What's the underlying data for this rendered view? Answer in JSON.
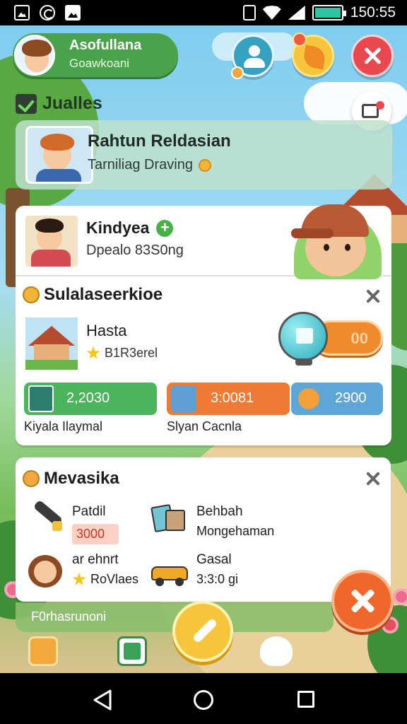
{
  "status_bar": {
    "time": "150:55"
  },
  "profile": {
    "name": "Asofullana",
    "subtitle": "Goawkoani"
  },
  "section": {
    "title": "Jualles"
  },
  "banner": {
    "title": "Rahtun Reldasian",
    "subtitle": "Tarniliag Draving"
  },
  "kid": {
    "name": "Kindyea",
    "subtitle": "Dpealo 83S0ng"
  },
  "subsection": {
    "title": "Sulalaseerkioe"
  },
  "place": {
    "name": "Hasta",
    "rating_text": "B1R3erel",
    "toggle_label": "00"
  },
  "stats": [
    {
      "value": "2,2030",
      "label": "Kiyala Ilaymal",
      "color": "#4cb45c"
    },
    {
      "value": "3:0081",
      "label": "Slyan Cacnla",
      "color": "#ef7a33"
    },
    {
      "value": "2900",
      "label": "",
      "color": "#5fa6d8"
    }
  ],
  "card2": {
    "title": "Mevasika",
    "items": [
      {
        "label": "Patdil",
        "value": "3000",
        "icon": "wrench-icon"
      },
      {
        "label": "Behbah",
        "value": "Mongehaman",
        "icon": "map-icon"
      },
      {
        "label": "ar ehnrt",
        "value": "RoVlaes",
        "icon": "girl-avatar-icon"
      },
      {
        "label": "Gasal",
        "value": "3:3:0 gi",
        "icon": "car-icon"
      }
    ]
  },
  "tip": {
    "text": "F0rhasrunoni"
  }
}
